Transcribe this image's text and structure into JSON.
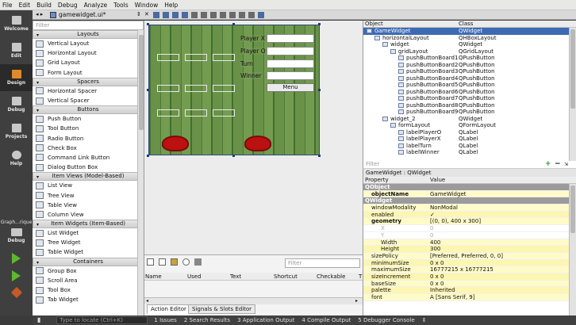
{
  "menubar": [
    "File",
    "Edit",
    "Build",
    "Debug",
    "Analyze",
    "Tools",
    "Window",
    "Help"
  ],
  "modes": [
    {
      "label": "Welcome",
      "icon": "grid-icon"
    },
    {
      "label": "Edit",
      "icon": "document-icon"
    },
    {
      "label": "Design",
      "icon": "pencil-icon"
    },
    {
      "label": "Debug",
      "icon": "bug-icon"
    },
    {
      "label": "Projects",
      "icon": "wrench-icon"
    },
    {
      "label": "Help",
      "icon": "help-icon"
    }
  ],
  "kit": {
    "label": "Graph...rique",
    "build": "Debug"
  },
  "editor_tab": {
    "filename": "gamewidget.ui*"
  },
  "widgetbox": {
    "filter_placeholder": "Filter",
    "layouts_header": "Layouts",
    "layouts": [
      "Vertical Layout",
      "Horizontal Layout",
      "Grid Layout",
      "Form Layout"
    ],
    "spacers_header": "Spacers",
    "spacers": [
      "Horizontal Spacer",
      "Vertical Spacer"
    ],
    "buttons_header": "Buttons",
    "buttons": [
      "Push Button",
      "Tool Button",
      "Radio Button",
      "Check Box",
      "Command Link Button",
      "Dialog Button Box"
    ],
    "views_header": "Item Views (Model-Based)",
    "views": [
      "List View",
      "Tree View",
      "Table View",
      "Column View"
    ],
    "widgets_header": "Item Widgets (Item-Based)",
    "widgets": [
      "List Widget",
      "Tree Widget",
      "Table Widget"
    ],
    "containers_header": "Containers",
    "containers": [
      "Group Box",
      "Scroll Area",
      "Tool Box",
      "Tab Widget"
    ]
  },
  "form": {
    "labels": [
      "Player X",
      "Player O",
      "Turn",
      "Winner"
    ],
    "menu_button": "Menu"
  },
  "action_editor": {
    "filter_placeholder": "Filter",
    "columns": [
      "Name",
      "Used",
      "Text",
      "Shortcut",
      "Checkable",
      "T"
    ],
    "tabs": [
      "Action Editor",
      "Signals & Slots Editor"
    ]
  },
  "object_inspector": {
    "headers": [
      "Object",
      "Class"
    ],
    "rows": [
      {
        "name": "GameWidget",
        "cls": "QWidget",
        "indent": 0,
        "sel": true
      },
      {
        "name": "horizontalLayout",
        "cls": "QHBoxLayout",
        "indent": 1
      },
      {
        "name": "widget",
        "cls": "QWidget",
        "indent": 2
      },
      {
        "name": "gridLayout",
        "cls": "QGridLayout",
        "indent": 3
      },
      {
        "name": "pushButtonBoard1",
        "cls": "QPushButton",
        "indent": 4
      },
      {
        "name": "pushButtonBoard2",
        "cls": "QPushButton",
        "indent": 4
      },
      {
        "name": "pushButtonBoard3",
        "cls": "QPushButton",
        "indent": 4
      },
      {
        "name": "pushButtonBoard4",
        "cls": "QPushButton",
        "indent": 4
      },
      {
        "name": "pushButtonBoard5",
        "cls": "QPushButton",
        "indent": 4
      },
      {
        "name": "pushButtonBoard6",
        "cls": "QPushButton",
        "indent": 4
      },
      {
        "name": "pushButtonBoard7",
        "cls": "QPushButton",
        "indent": 4
      },
      {
        "name": "pushButtonBoard8",
        "cls": "QPushButton",
        "indent": 4
      },
      {
        "name": "pushButtonBoard9",
        "cls": "QPushButton",
        "indent": 4
      },
      {
        "name": "widget_2",
        "cls": "QWidget",
        "indent": 2
      },
      {
        "name": "formLayout",
        "cls": "QFormLayout",
        "indent": 3
      },
      {
        "name": "labelPlayerO",
        "cls": "QLabel",
        "indent": 4
      },
      {
        "name": "labelPlayerX",
        "cls": "QLabel",
        "indent": 4
      },
      {
        "name": "labelTurn",
        "cls": "QLabel",
        "indent": 4
      },
      {
        "name": "labelWinner",
        "cls": "QLabel",
        "indent": 4
      }
    ]
  },
  "property_editor": {
    "filter_placeholder": "Filter",
    "class_label": "GameWidget : QWidget",
    "headers": [
      "Property",
      "Value"
    ],
    "rows": [
      {
        "p": "QObject",
        "v": "",
        "k": "grp"
      },
      {
        "p": "objectName",
        "v": "GameWidget",
        "k": "y",
        "b": true
      },
      {
        "p": "QWidget",
        "v": "",
        "k": "grp"
      },
      {
        "p": "windowModality",
        "v": "NonModal",
        "k": "y"
      },
      {
        "p": "enabled",
        "v": "✓",
        "k": "y2"
      },
      {
        "p": "geometry",
        "v": "[(0, 0), 400 x 300]",
        "k": "y",
        "b": true
      },
      {
        "p": "X",
        "v": "0",
        "k": "dis"
      },
      {
        "p": "Y",
        "v": "0",
        "k": "dis"
      },
      {
        "p": "Width",
        "v": "400",
        "k": "y"
      },
      {
        "p": "Height",
        "v": "300",
        "k": "y2"
      },
      {
        "p": "sizePolicy",
        "v": "[Preferred, Preferred, 0, 0]",
        "k": "y"
      },
      {
        "p": "minimumSize",
        "v": "0 x 0",
        "k": "y2"
      },
      {
        "p": "maximumSize",
        "v": "16777215 x 16777215",
        "k": "y"
      },
      {
        "p": "sizeIncrement",
        "v": "0 x 0",
        "k": "y2"
      },
      {
        "p": "baseSize",
        "v": "0 x 0",
        "k": "y"
      },
      {
        "p": "palette",
        "v": "Inherited",
        "k": "y2"
      },
      {
        "p": "font",
        "v": "A  [Sans Serif, 9]",
        "k": "y"
      }
    ]
  },
  "statusbar": {
    "locate_placeholder": "Type to locate (Ctrl+K)",
    "items": [
      "1 Issues",
      "2 Search Results",
      "3 Application Output",
      "4 Compile Output",
      "5 Debugger Console"
    ]
  }
}
